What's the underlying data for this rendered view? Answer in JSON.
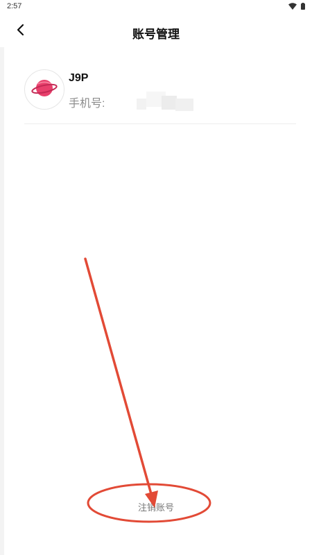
{
  "status_bar": {
    "time": "2:57",
    "wifi_icon": "wifi-icon",
    "battery_icon": "battery-icon"
  },
  "header": {
    "title": "账号管理",
    "back_icon": "chevron-left-icon"
  },
  "profile": {
    "name": "J9P",
    "phone_label": "手机号:",
    "avatar_icon": "planet-icon",
    "avatar_color": "#e8406c"
  },
  "footer": {
    "deregister_label": "注销账号"
  },
  "annotation": {
    "color": "#e24a36"
  }
}
